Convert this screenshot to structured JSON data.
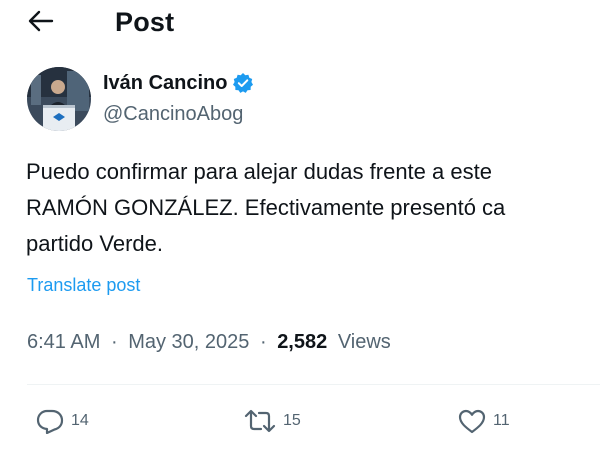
{
  "header": {
    "title": "Post",
    "back_icon": "arrow-left-icon"
  },
  "author": {
    "name": "Iván Cancino",
    "handle": "@CancinoAbog",
    "verified_icon": "verified-badge-icon",
    "verified_color": "#1d9bf0"
  },
  "post": {
    "lines": [
      "Puedo confirmar para alejar dudas frente a este",
      "RAMÓN GONZÁLEZ. Efectivamente presentó ca",
      "partido Verde."
    ],
    "translate_label": "Translate post"
  },
  "meta": {
    "time": "6:41 AM",
    "separator": "·",
    "date": "May 30, 2025",
    "views_count": "2,582",
    "views_label": "Views"
  },
  "actions": {
    "replies": "14",
    "reposts": "15",
    "likes": "11"
  },
  "colors": {
    "text": "#0f1419",
    "secondary": "#536471",
    "link": "#1d9bf0"
  }
}
